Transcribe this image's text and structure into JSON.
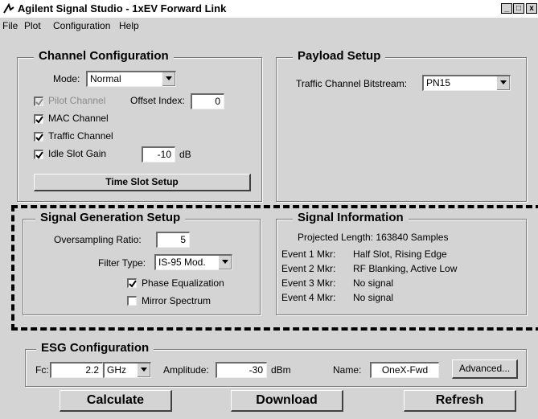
{
  "window": {
    "title": "Agilent Signal Studio - 1xEV Forward Link",
    "controls": [
      "_",
      "□",
      "x"
    ]
  },
  "menu": {
    "file": "File",
    "plot": "Plot",
    "configuration": "Configuration",
    "help": "Help"
  },
  "channel_config": {
    "title": "Channel Configuration",
    "mode_label": "Mode:",
    "mode_value": "Normal",
    "pilot_label": "Pilot Channel",
    "offset_label": "Offset Index:",
    "offset_value": "0",
    "mac_label": "MAC Channel",
    "traffic_label": "Traffic Channel",
    "idle_label": "Idle Slot Gain",
    "idle_value": "-10",
    "idle_unit": "dB",
    "time_slot_button": "Time Slot Setup",
    "pilot_checked": true,
    "pilot_enabled": false,
    "mac_checked": true,
    "traffic_checked": true,
    "idle_checked": true
  },
  "payload": {
    "title": "Payload Setup",
    "bitstream_label": "Traffic Channel Bitstream:",
    "bitstream_value": "PN15"
  },
  "signal_gen": {
    "title": "Signal Generation Setup",
    "oversampling_label": "Oversampling Ratio:",
    "oversampling_value": "5",
    "filter_label": "Filter Type:",
    "filter_value": "IS-95 Mod.",
    "phase_label": "Phase Equalization",
    "mirror_label": "Mirror Spectrum",
    "phase_checked": true,
    "mirror_checked": false
  },
  "signal_info": {
    "title": "Signal Information",
    "projected": "Projected Length: 163840 Samples",
    "events": [
      {
        "label": "Event 1 Mkr:",
        "value": "Half Slot, Rising Edge"
      },
      {
        "label": "Event 2 Mkr:",
        "value": "RF Blanking, Active Low"
      },
      {
        "label": "Event 3 Mkr:",
        "value": "No signal"
      },
      {
        "label": "Event 4 Mkr:",
        "value": "No signal"
      }
    ]
  },
  "esg": {
    "title": "ESG Configuration",
    "fc_label": "Fc:",
    "fc_value": "2.2",
    "fc_unit": "GHz",
    "amp_label": "Amplitude:",
    "amp_value": "-30",
    "amp_unit": "dBm",
    "name_label": "Name:",
    "name_value": "OneX-Fwd",
    "advanced_button": "Advanced..."
  },
  "actions": {
    "calculate": "Calculate",
    "download": "Download",
    "refresh": "Refresh"
  }
}
